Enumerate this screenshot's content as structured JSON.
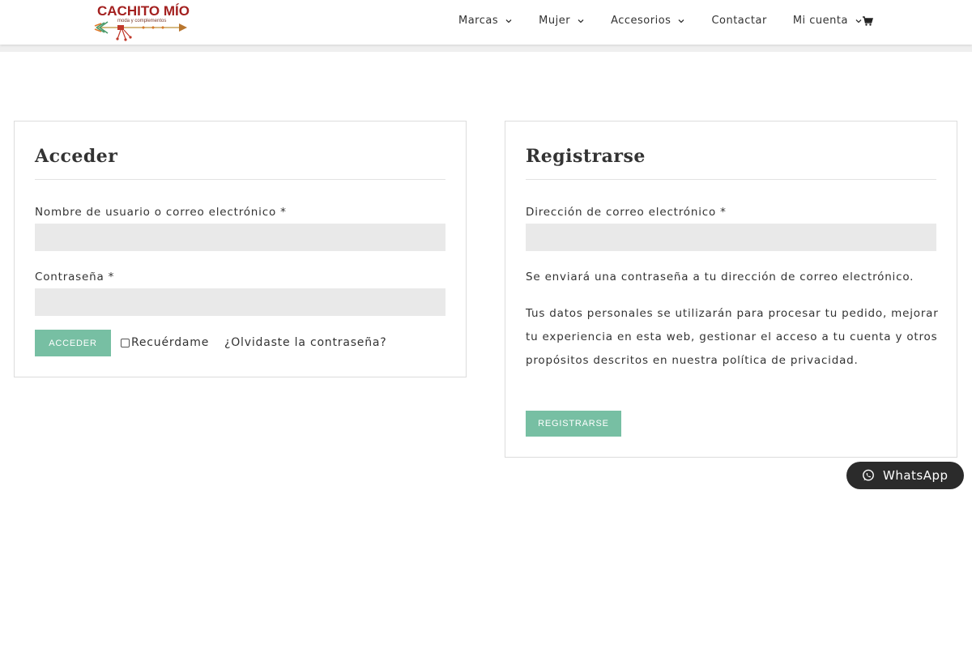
{
  "brand": {
    "name": "CACHITO MÍO",
    "tagline": "moda y complementos",
    "colors": {
      "title": "#a3201f",
      "accent": "#77bfa3"
    }
  },
  "nav": {
    "items": [
      {
        "label": "Marcas",
        "has_dropdown": true
      },
      {
        "label": "Mujer",
        "has_dropdown": true
      },
      {
        "label": "Accesorios",
        "has_dropdown": true
      },
      {
        "label": "Contactar",
        "has_dropdown": false
      },
      {
        "label": "Mi cuenta",
        "has_dropdown": true
      }
    ],
    "cart_icon": "shopping-cart-icon"
  },
  "login": {
    "title": "Acceder",
    "username_label": "Nombre de usuario o correo electrónico",
    "password_label": "Contraseña",
    "required_marker": "*",
    "username_value": "",
    "password_value": "",
    "submit_label": "ACCEDER",
    "remember_label": "Recuérdame",
    "remember_checked": false,
    "lost_password": "¿Olvidaste la contraseña?"
  },
  "register": {
    "title": "Registrarse",
    "email_label": "Dirección de correo electrónico",
    "required_marker": "*",
    "email_value": "",
    "password_note": "Se enviará una contraseña a tu dirección de correo electrónico.",
    "privacy_text": "Tus datos personales se utilizarán para procesar tu pedido, mejorar tu experiencia en esta web, gestionar el acceso a tu cuenta y otros propósitos descritos en nuestra política de privacidad.",
    "submit_label": "REGISTRARSE"
  },
  "whatsapp": {
    "label": "WhatsApp",
    "icon": "whatsapp-icon"
  }
}
